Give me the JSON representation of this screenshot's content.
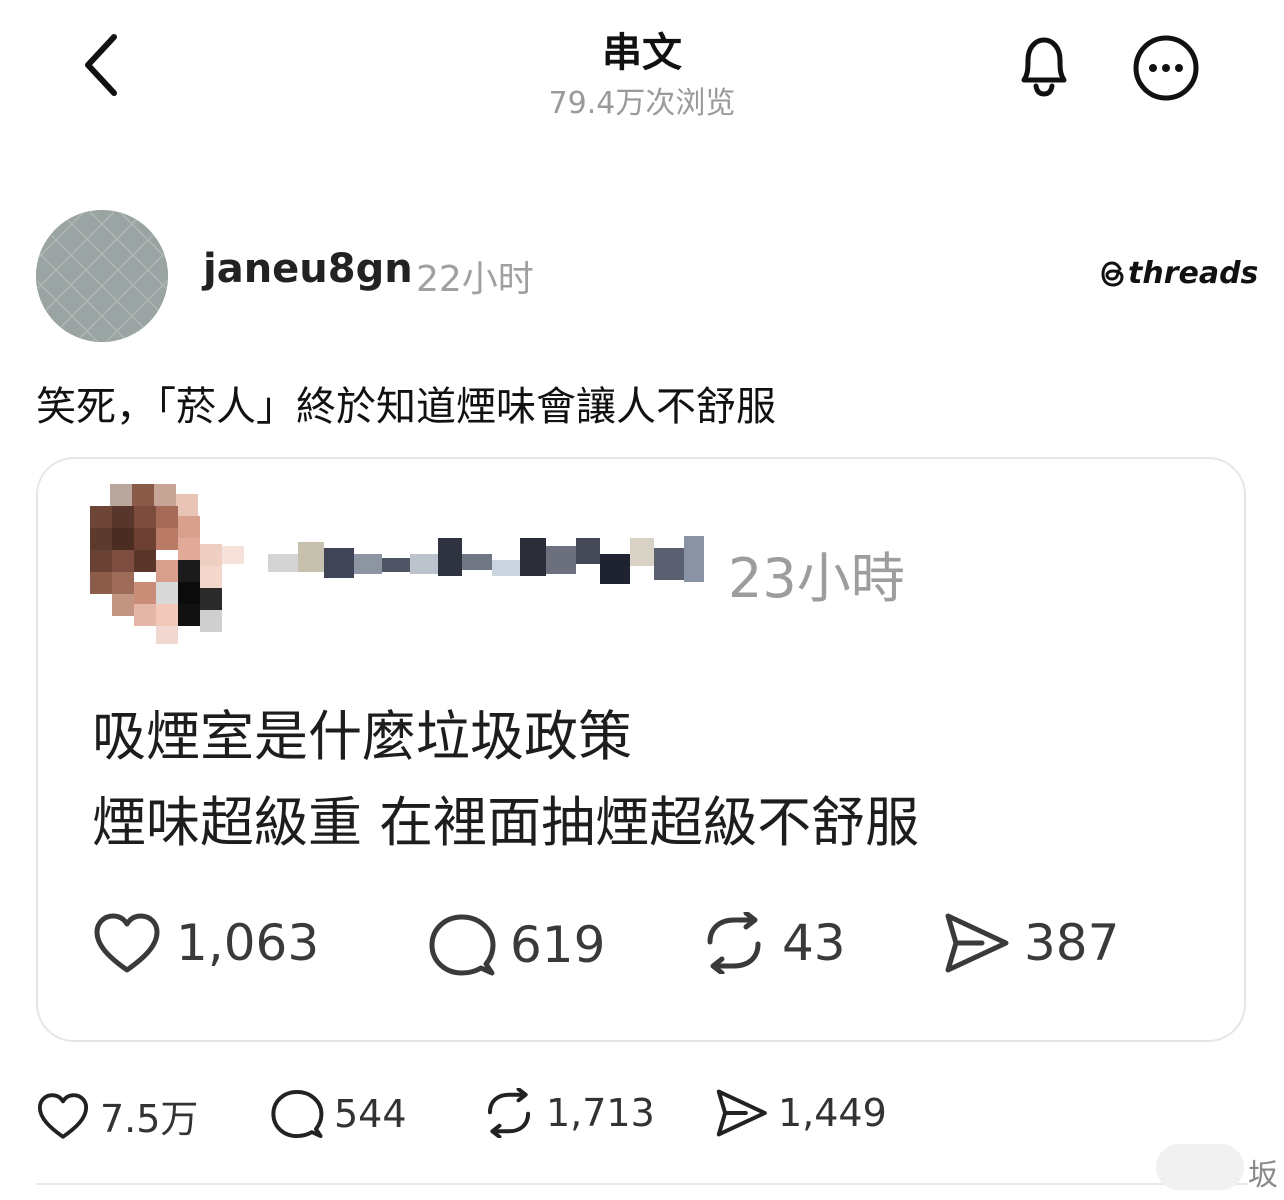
{
  "header": {
    "title": "串文",
    "views": "79.4万次浏览"
  },
  "post": {
    "username": "janeu8gn",
    "time": "22小时",
    "brand": "threads",
    "text": "笑死，「菸人」終於知道煙味會讓人不舒服",
    "actions": {
      "likes": "7.5万",
      "comments": "544",
      "reposts": "1,713",
      "shares": "1,449"
    }
  },
  "quoted": {
    "time": "23小時",
    "line1": "吸煙室是什麼垃圾政策",
    "line2": "煙味超級重 在裡面抽煙超級不舒服",
    "stats": {
      "likes": "1,063",
      "comments": "619",
      "reposts": "43",
      "shares": "387"
    }
  },
  "watermark": {
    "char": "坂"
  },
  "colors": {
    "text": "#111111",
    "muted": "#9a9a9a",
    "card_border": "#e6e6e6",
    "avatar": "#9aa4a2"
  },
  "icons": [
    "back-arrow-icon",
    "bell-icon",
    "more-icon",
    "heart-icon",
    "comment-icon",
    "repost-icon",
    "share-icon",
    "threads-logo-icon"
  ]
}
